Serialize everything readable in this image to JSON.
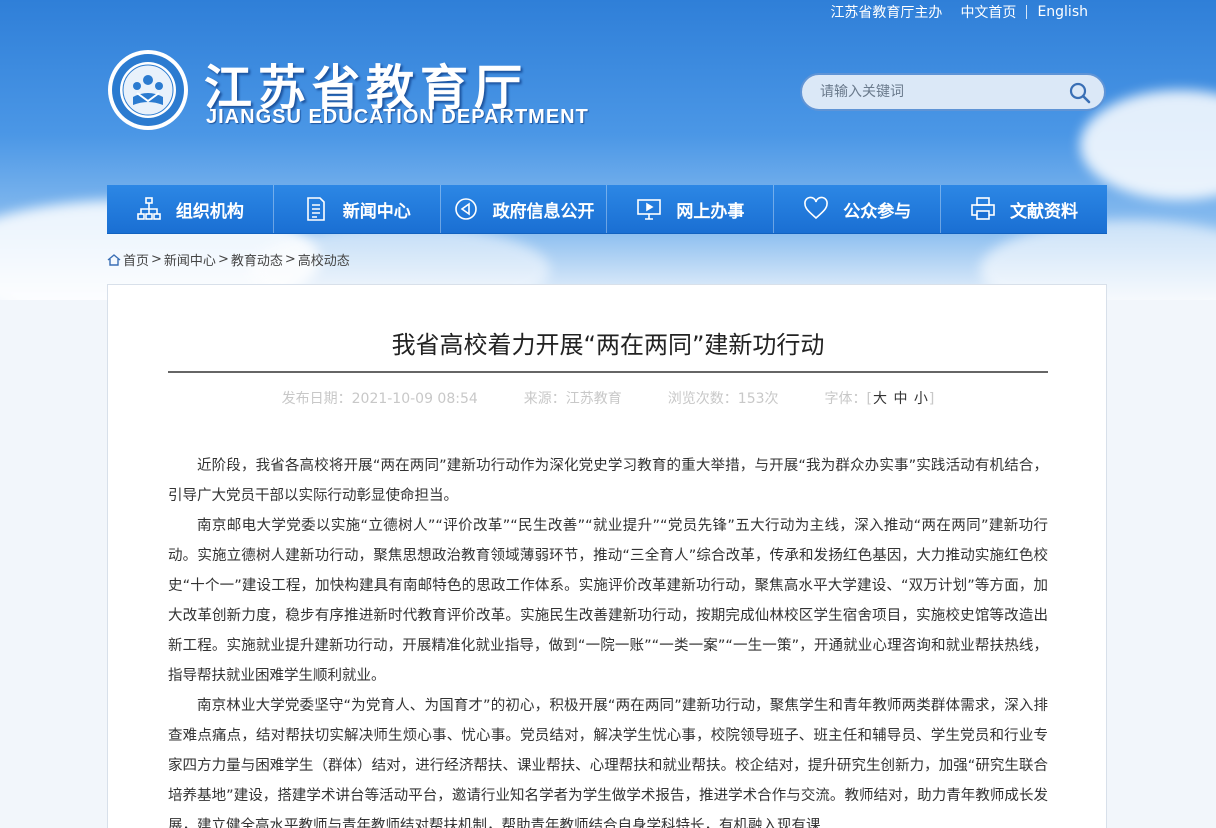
{
  "header": {
    "host_label": "江苏省教育厅主办",
    "links": [
      "中文首页",
      "English"
    ],
    "title_cn": "江苏省教育厅",
    "title_en": "JIANGSU EDUCATION DEPARTMENT",
    "search_placeholder": "请输入关键词"
  },
  "nav": {
    "items": [
      {
        "label": "组织机构",
        "icon": "org-chart-icon"
      },
      {
        "label": "新闻中心",
        "icon": "document-icon"
      },
      {
        "label": "政府信息公开",
        "icon": "announcement-icon"
      },
      {
        "label": "网上办事",
        "icon": "monitor-icon"
      },
      {
        "label": "公众参与",
        "icon": "heart-icon"
      },
      {
        "label": "文献资料",
        "icon": "printer-icon"
      }
    ]
  },
  "breadcrumb": {
    "items": [
      "首页",
      "新闻中心",
      "教育动态",
      "高校动态"
    ],
    "sep": ">"
  },
  "article": {
    "title": "我省高校着力开展“两在两同”建新功行动",
    "publish": "发布日期：2021-10-09 08:54",
    "source": "来源：江苏教育",
    "views": "浏览次数：153次",
    "font_label": "字体：[",
    "font_large": "大",
    "font_mid": "中",
    "font_small": "小",
    "font_close": "]",
    "paragraphs": [
      "近阶段，我省各高校将开展“两在两同”建新功行动作为深化党史学习教育的重大举措，与开展“我为群众办实事”实践活动有机结合，引导广大党员干部以实际行动彰显使命担当。",
      "南京邮电大学党委以实施“立德树人”“评价改革”“民生改善”“就业提升”“党员先锋”五大行动为主线，深入推动“两在两同”建新功行动。实施立德树人建新功行动，聚焦思想政治教育领域薄弱环节，推动“三全育人”综合改革，传承和发扬红色基因，大力推动实施红色校史“十个一”建设工程，加快构建具有南邮特色的思政工作体系。实施评价改革建新功行动，聚焦高水平大学建设、“双万计划”等方面，加大改革创新力度，稳步有序推进新时代教育评价改革。实施民生改善建新功行动，按期完成仙林校区学生宿舍项目，实施校史馆等改造出新工程。实施就业提升建新功行动，开展精准化就业指导，做到“一院一账”“一类一案”“一生一策”，开通就业心理咨询和就业帮扶热线，指导帮扶就业困难学生顺利就业。",
      "南京林业大学党委坚守“为党育人、为国育才”的初心，积极开展“两在两同”建新功行动，聚焦学生和青年教师两类群体需求，深入排查难点痛点，结对帮扶切实解决师生烦心事、忧心事。党员结对，解决学生忧心事，校院领导班子、班主任和辅导员、学生党员和行业专家四方力量与困难学生（群体）结对，进行经济帮扶、课业帮扶、心理帮扶和就业帮扶。校企结对，提升研究生创新力，加强“研究生联合培养基地”建设，搭建学术讲台等活动平台，邀请行业知名学者为学生做学术报告，推进学术合作与交流。教师结对，助力青年教师成长发展，建立健全高水平教师与青年教师结对帮扶机制，帮助青年教师结合自身学科特长，有机融入现有课"
    ]
  }
}
